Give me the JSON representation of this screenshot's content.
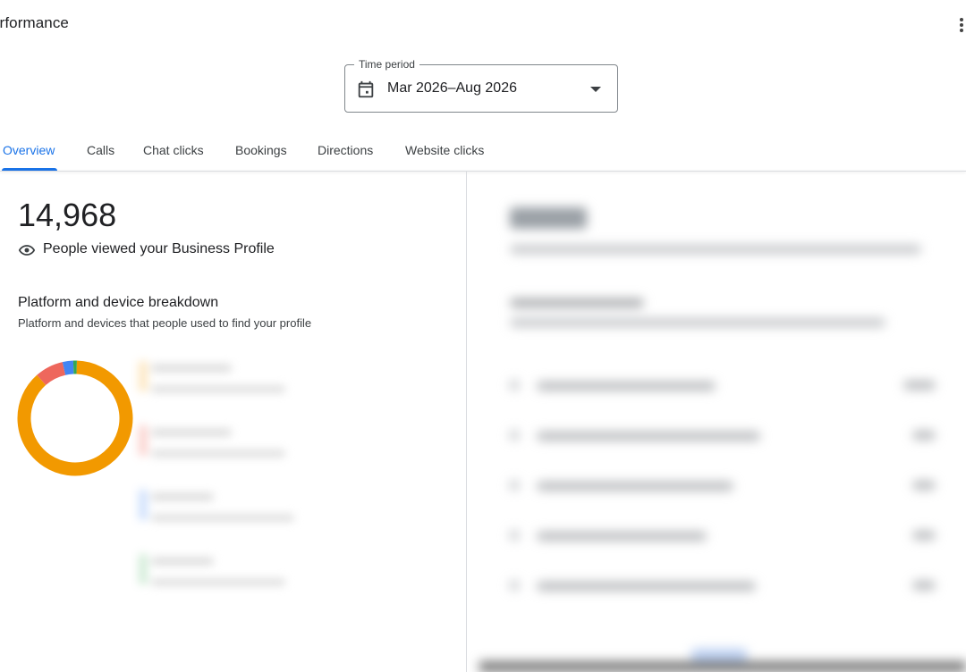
{
  "header": {
    "title": "erformance"
  },
  "time_period": {
    "label": "Time period",
    "value": "Mar 2026–Aug 2026"
  },
  "tabs": [
    {
      "label": "Overview",
      "active": true
    },
    {
      "label": "Calls",
      "active": false
    },
    {
      "label": "Chat clicks",
      "active": false
    },
    {
      "label": "Bookings",
      "active": false
    },
    {
      "label": "Directions",
      "active": false
    },
    {
      "label": "Website clicks",
      "active": false
    }
  ],
  "overview": {
    "views_count": "14,968",
    "views_label": "People viewed your Business Profile",
    "breakdown_title": "Platform and device breakdown",
    "breakdown_subtitle": "Platform and devices that people used to find your profile"
  },
  "chart_data": {
    "type": "pie",
    "donut": true,
    "values": [
      88,
      8,
      3,
      1
    ],
    "colors": [
      "#f29900",
      "#ee675c",
      "#4285f4",
      "#34a853"
    ]
  },
  "colors": {
    "accent": "#1a73e8"
  }
}
